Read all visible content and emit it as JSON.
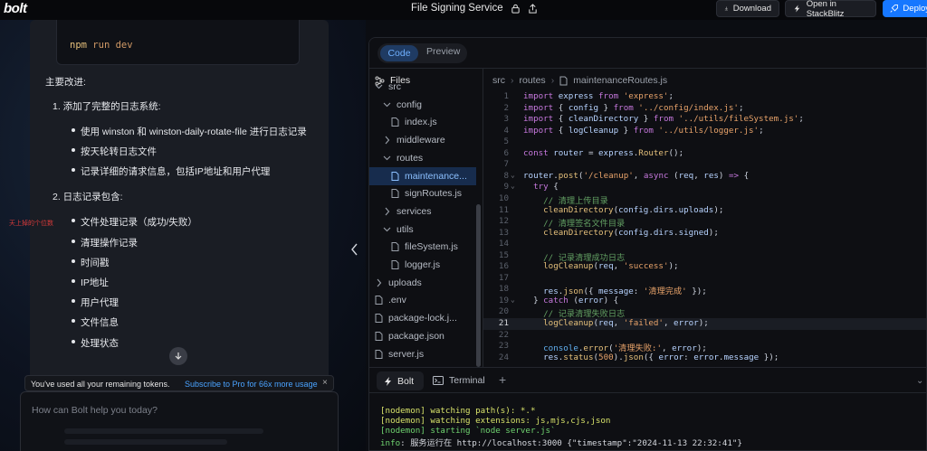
{
  "header": {
    "logo": "bolt",
    "project_title": "File Signing Service",
    "download_label": "Download",
    "open_label": "Open in StackBlitz",
    "deploy_label": "Deploy"
  },
  "chat": {
    "snippet_cmd": "npm",
    "snippet_arg": "run dev",
    "intro": "主要改进:",
    "section1": "1. 添加了完整的日志系统:",
    "section1_items": [
      "使用 winston 和 winston-daily-rotate-file 进行日志记录",
      "按天轮转日志文件",
      "记录详细的请求信息，包括IP地址和用户代理"
    ],
    "section2": "2. 日志记录包含:",
    "section2_items": [
      "文件处理记录（成功/失败）",
      "清理操作记录",
      "时间戳",
      "IP地址",
      "用户代理",
      "文件信息",
      "处理状态"
    ],
    "side_note": "天上掉的个位数",
    "token_notice": "You've used all your remaining tokens.",
    "subscribe_link": "Subscribe to Pro for 66x more usage",
    "close_symbol": "×",
    "input_placeholder": "How can Bolt help you today?"
  },
  "workbench": {
    "tab_code": "Code",
    "tab_preview": "Preview",
    "files_label": "Files",
    "tree": [
      {
        "label": "src",
        "kind": "folder",
        "indent": 0
      },
      {
        "label": "config",
        "kind": "folder",
        "indent": 1
      },
      {
        "label": "index.js",
        "kind": "file",
        "indent": 2
      },
      {
        "label": "middleware",
        "kind": "folder-closed",
        "indent": 1
      },
      {
        "label": "routes",
        "kind": "folder",
        "indent": 1
      },
      {
        "label": "maintenance...",
        "kind": "file",
        "indent": 2,
        "active": true
      },
      {
        "label": "signRoutes.js",
        "kind": "file",
        "indent": 2
      },
      {
        "label": "services",
        "kind": "folder-closed",
        "indent": 1
      },
      {
        "label": "utils",
        "kind": "folder",
        "indent": 1
      },
      {
        "label": "fileSystem.js",
        "kind": "file",
        "indent": 2
      },
      {
        "label": "logger.js",
        "kind": "file",
        "indent": 2
      },
      {
        "label": "uploads",
        "kind": "folder-closed",
        "indent": 0
      },
      {
        "label": ".env",
        "kind": "file",
        "indent": 0
      },
      {
        "label": "package-lock.j...",
        "kind": "file",
        "indent": 0
      },
      {
        "label": "package.json",
        "kind": "file",
        "indent": 0
      },
      {
        "label": "server.js",
        "kind": "file",
        "indent": 0
      }
    ],
    "breadcrumb": [
      "src",
      "routes",
      "maintenanceRoutes.js"
    ],
    "code_lines": [
      [
        [
          "k",
          "import "
        ],
        [
          "v",
          "express "
        ],
        [
          "k",
          "from "
        ],
        [
          "s",
          "'express'"
        ],
        [
          "p",
          ";"
        ]
      ],
      [
        [
          "k",
          "import "
        ],
        [
          "p",
          "{ "
        ],
        [
          "v",
          "config "
        ],
        [
          "p",
          "} "
        ],
        [
          "k",
          "from "
        ],
        [
          "s",
          "'../config/index.js'"
        ],
        [
          "p",
          ";"
        ]
      ],
      [
        [
          "k",
          "import "
        ],
        [
          "p",
          "{ "
        ],
        [
          "v",
          "cleanDirectory "
        ],
        [
          "p",
          "} "
        ],
        [
          "k",
          "from "
        ],
        [
          "s",
          "'../utils/fileSystem.js'"
        ],
        [
          "p",
          ";"
        ]
      ],
      [
        [
          "k",
          "import "
        ],
        [
          "p",
          "{ "
        ],
        [
          "v",
          "logCleanup "
        ],
        [
          "p",
          "} "
        ],
        [
          "k",
          "from "
        ],
        [
          "s",
          "'../utils/logger.js'"
        ],
        [
          "p",
          ";"
        ]
      ],
      [],
      [
        [
          "k",
          "const "
        ],
        [
          "v",
          "router "
        ],
        [
          "p",
          "= "
        ],
        [
          "v",
          "express"
        ],
        [
          "p",
          "."
        ],
        [
          "f",
          "Router"
        ],
        [
          "p",
          "();"
        ]
      ],
      [],
      [
        [
          "v",
          "router"
        ],
        [
          "p",
          "."
        ],
        [
          "f",
          "post"
        ],
        [
          "p",
          "("
        ],
        [
          "s",
          "'/cleanup'"
        ],
        [
          "p",
          ", "
        ],
        [
          "k",
          "async "
        ],
        [
          "p",
          "("
        ],
        [
          "v",
          "req"
        ],
        [
          "p",
          ", "
        ],
        [
          "v",
          "res"
        ],
        [
          "p",
          ") "
        ],
        [
          "k",
          "=> "
        ],
        [
          "p",
          "{"
        ]
      ],
      [
        [
          "p",
          "  "
        ],
        [
          "k",
          "try "
        ],
        [
          "p",
          "{"
        ]
      ],
      [
        [
          "p",
          "    "
        ],
        [
          "c",
          "// 清理上传目录"
        ]
      ],
      [
        [
          "p",
          "    "
        ],
        [
          "f",
          "cleanDirectory"
        ],
        [
          "p",
          "("
        ],
        [
          "v",
          "config"
        ],
        [
          "p",
          "."
        ],
        [
          "v",
          "dirs"
        ],
        [
          "p",
          "."
        ],
        [
          "v",
          "uploads"
        ],
        [
          "p",
          ");"
        ]
      ],
      [
        [
          "p",
          "    "
        ],
        [
          "c",
          "// 清理签名文件目录"
        ]
      ],
      [
        [
          "p",
          "    "
        ],
        [
          "f",
          "cleanDirectory"
        ],
        [
          "p",
          "("
        ],
        [
          "v",
          "config"
        ],
        [
          "p",
          "."
        ],
        [
          "v",
          "dirs"
        ],
        [
          "p",
          "."
        ],
        [
          "v",
          "signed"
        ],
        [
          "p",
          ");"
        ]
      ],
      [],
      [
        [
          "p",
          "    "
        ],
        [
          "c",
          "// 记录清理成功日志"
        ]
      ],
      [
        [
          "p",
          "    "
        ],
        [
          "f",
          "logCleanup"
        ],
        [
          "p",
          "("
        ],
        [
          "v",
          "req"
        ],
        [
          "p",
          ", "
        ],
        [
          "s",
          "'success'"
        ],
        [
          "p",
          ");"
        ]
      ],
      [],
      [
        [
          "p",
          "    "
        ],
        [
          "v",
          "res"
        ],
        [
          "p",
          "."
        ],
        [
          "f",
          "json"
        ],
        [
          "p",
          "({ "
        ],
        [
          "v",
          "message"
        ],
        [
          "p",
          ": "
        ],
        [
          "s",
          "'清理完成' "
        ],
        [
          "p",
          "});"
        ]
      ],
      [
        [
          "p",
          "  } "
        ],
        [
          "k",
          "catch "
        ],
        [
          "p",
          "("
        ],
        [
          "v",
          "error"
        ],
        [
          "p",
          ") {"
        ]
      ],
      [
        [
          "p",
          "    "
        ],
        [
          "c",
          "// 记录清理失败日志"
        ]
      ],
      [
        [
          "p",
          "    "
        ],
        [
          "f",
          "logCleanup"
        ],
        [
          "p",
          "("
        ],
        [
          "v",
          "req"
        ],
        [
          "p",
          ", "
        ],
        [
          "s",
          "'failed'"
        ],
        [
          "p",
          ", "
        ],
        [
          "v",
          "error"
        ],
        [
          "p",
          ");"
        ]
      ],
      [],
      [
        [
          "p",
          "    "
        ],
        [
          "cl",
          "console"
        ],
        [
          "p",
          "."
        ],
        [
          "f",
          "error"
        ],
        [
          "p",
          "("
        ],
        [
          "s",
          "'清理失败:'"
        ],
        [
          "p",
          ", "
        ],
        [
          "v",
          "error"
        ],
        [
          "p",
          ");"
        ]
      ],
      [
        [
          "p",
          "    "
        ],
        [
          "v",
          "res"
        ],
        [
          "p",
          "."
        ],
        [
          "f",
          "status"
        ],
        [
          "p",
          "("
        ],
        [
          "s",
          "500"
        ],
        [
          "p",
          ")."
        ],
        [
          "f",
          "json"
        ],
        [
          "p",
          "({ "
        ],
        [
          "v",
          "error"
        ],
        [
          "p",
          ": "
        ],
        [
          "v",
          "error"
        ],
        [
          "p",
          "."
        ],
        [
          "v",
          "message "
        ],
        [
          "p",
          "});"
        ]
      ]
    ],
    "current_line": 21,
    "bottom_tab_bolt": "Bolt",
    "bottom_tab_terminal": "Terminal",
    "terminal_lines": [
      [
        [
          "tg",
          "[nodemon] watching path(s): *.*"
        ]
      ],
      [
        [
          "tg",
          "[nodemon] watching extensions: js,mjs,cjs,json"
        ]
      ],
      [
        [
          "tgr",
          "[nodemon] starting `node server.js`"
        ]
      ],
      [
        [
          "tgr",
          "info"
        ],
        [
          "tw",
          ": 服务运行在 http://localhost:3000 {\"timestamp\":\"2024-11-13 22:32:41\"}"
        ]
      ]
    ]
  }
}
